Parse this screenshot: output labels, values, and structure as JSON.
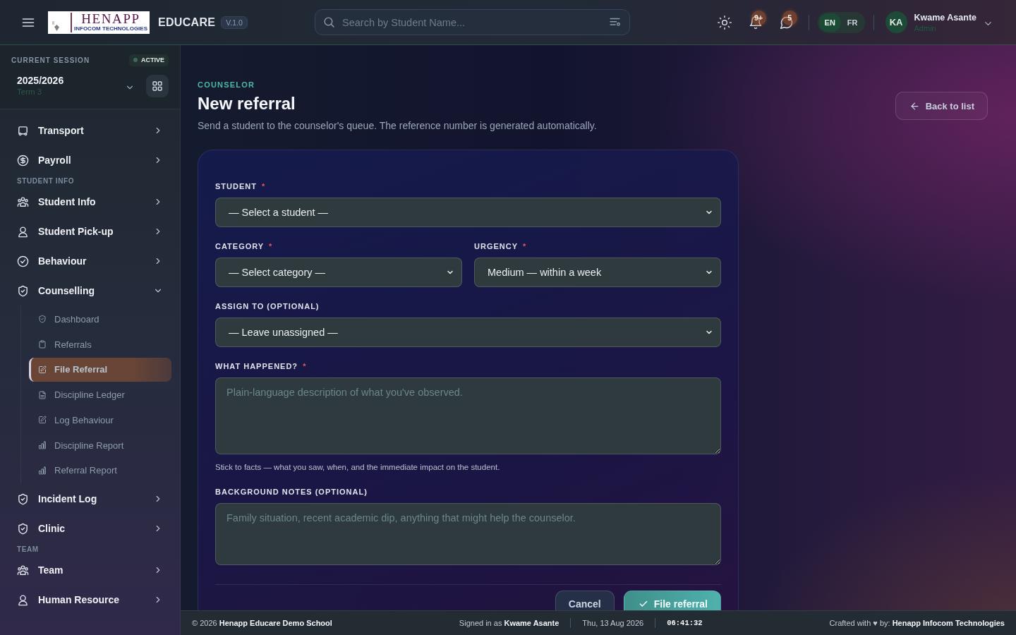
{
  "header": {
    "logo": {
      "title": "HENAPP",
      "subtitle": "INFOCOM TECHNOLOGIES"
    },
    "brand": "EDUCARE",
    "version": "V.1.0",
    "search": {
      "placeholder": "Search by Student Name..."
    },
    "notification_count": "9+",
    "message_count": "5",
    "languages": [
      {
        "label": "EN",
        "selected": true
      },
      {
        "label": "FR",
        "selected": false
      }
    ],
    "user": {
      "initials": "KA",
      "name": "Kwame Asante",
      "role": "Admin"
    }
  },
  "sidebar": {
    "session": {
      "label": "CURRENT SESSION",
      "status": "ACTIVE",
      "year": "2025/2026",
      "term": "Term 3"
    },
    "groups": [
      {
        "items": [
          {
            "label": "Transport",
            "expanded": false
          },
          {
            "label": "Payroll",
            "expanded": false
          }
        ]
      },
      {
        "heading": "STUDENT INFO",
        "items": [
          {
            "label": "Student Info",
            "expanded": false
          },
          {
            "label": "Student Pick-up",
            "expanded": false
          },
          {
            "label": "Behaviour",
            "expanded": false
          },
          {
            "label": "Counselling",
            "expanded": true,
            "children": [
              {
                "label": "Dashboard",
                "selected": false
              },
              {
                "label": "Referrals",
                "selected": false
              },
              {
                "label": "File Referral",
                "selected": true
              },
              {
                "label": "Discipline Ledger",
                "selected": false
              },
              {
                "label": "Log Behaviour",
                "selected": false
              },
              {
                "label": "Discipline Report",
                "selected": false
              },
              {
                "label": "Referral Report",
                "selected": false
              }
            ]
          },
          {
            "label": "Incident Log",
            "expanded": false
          },
          {
            "label": "Clinic",
            "expanded": false
          }
        ]
      },
      {
        "heading": "TEAM",
        "items": [
          {
            "label": "Team",
            "expanded": false
          },
          {
            "label": "Human Resource",
            "expanded": false
          }
        ]
      }
    ]
  },
  "page": {
    "eyebrow": "COUNSELOR",
    "title": "New referral",
    "subtitle": "Send a student to the counselor's queue. The reference number is generated automatically.",
    "back_button": "Back to list"
  },
  "form": {
    "rows": [
      [
        {
          "kind": "select",
          "label": "STUDENT",
          "required_mark": "*",
          "value": "— Select a student —"
        }
      ],
      [
        {
          "kind": "select",
          "label": "CATEGORY",
          "required_mark": "*",
          "value": "— Select category —"
        },
        {
          "kind": "select",
          "label": "URGENCY",
          "required_mark": "*",
          "value": "Medium — within a week"
        }
      ],
      [
        {
          "kind": "select",
          "label": "ASSIGN TO (OPTIONAL)",
          "value": "— Leave unassigned —"
        }
      ],
      [
        {
          "kind": "textarea",
          "label": "WHAT HAPPENED?",
          "required_mark": "*",
          "placeholder": "Plain-language description of what you've observed.",
          "help": "Stick to facts — what you saw, when, and the immediate impact on the student."
        }
      ],
      [
        {
          "kind": "textarea",
          "label": "BACKGROUND NOTES (OPTIONAL)",
          "placeholder": "Family situation, recent academic dip, anything that might help the counselor."
        }
      ]
    ],
    "buttons": [
      {
        "kind": "secondary",
        "label": "Cancel"
      },
      {
        "kind": "primary",
        "label": "File referral"
      }
    ]
  },
  "footer": {
    "copyright": "© 2026 **Henapp Educare Demo School**",
    "signed_in": "Signed in as **Kwame Asante**",
    "date": "Thu, 13 Aug 2026",
    "time": "06:41:32",
    "credit": "Crafted with ♥ by: **Henapp Infocom Technologies**"
  }
}
